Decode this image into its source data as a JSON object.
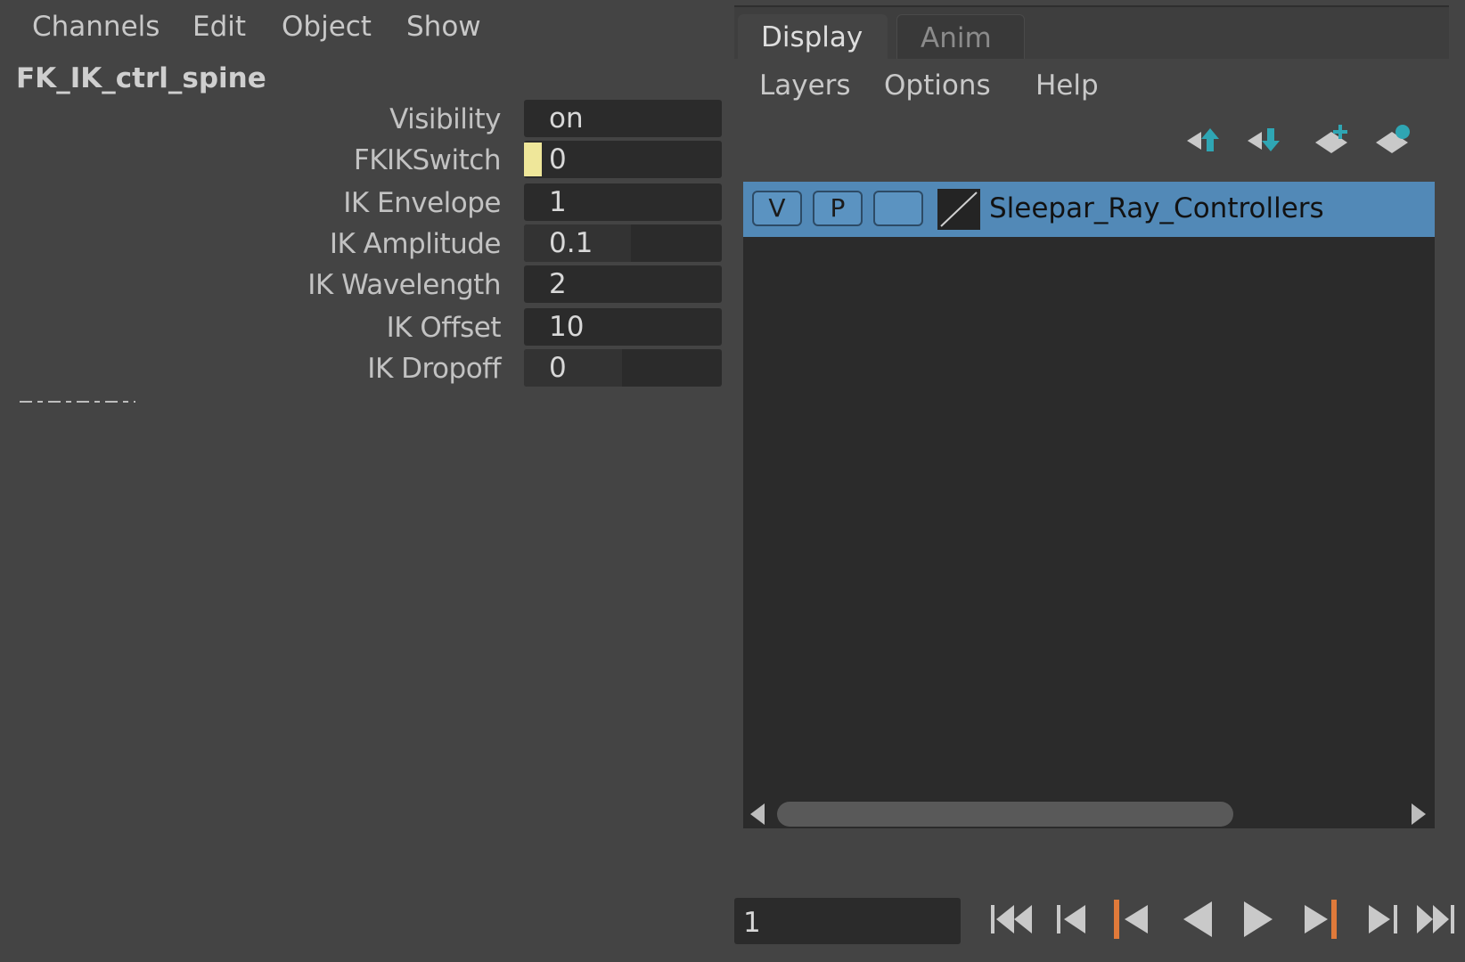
{
  "channel_box": {
    "menu": [
      "Channels",
      "Edit",
      "Object",
      "Show"
    ],
    "node_name": "FK_IK_ctrl_spine",
    "attributes": [
      {
        "label": "Visibility",
        "value": "on"
      },
      {
        "label": "FKIKSwitch",
        "value": "0"
      },
      {
        "label": "IK Envelope",
        "value": "1"
      },
      {
        "label": "IK Amplitude",
        "value": "0.1"
      },
      {
        "label": "IK Wavelength",
        "value": "2"
      },
      {
        "label": "IK Offset",
        "value": "10"
      },
      {
        "label": "IK Dropoff",
        "value": "0"
      }
    ],
    "keyed_color": "#efe79a"
  },
  "layer_editor": {
    "tabs": [
      "Display",
      "Anim"
    ],
    "menu": [
      "Layers",
      "Options",
      "Help"
    ],
    "toolbar_icons": [
      "move-layer-up-icon",
      "move-layer-down-icon",
      "create-empty-layer-icon",
      "create-layer-from-selected-icon"
    ],
    "layers": [
      {
        "visible": "V",
        "playback": "P",
        "name": "Sleepar_Ray_Controllers"
      }
    ],
    "selected_color": "#5289b7"
  },
  "time_controls": {
    "current_frame": "1",
    "accent_color": "#e07a3a",
    "buttons": [
      "go-to-start-icon",
      "step-back-frame-icon",
      "step-back-key-icon",
      "play-backwards-icon",
      "play-forwards-icon",
      "step-forward-key-icon",
      "step-forward-frame-icon",
      "go-to-end-icon"
    ]
  }
}
